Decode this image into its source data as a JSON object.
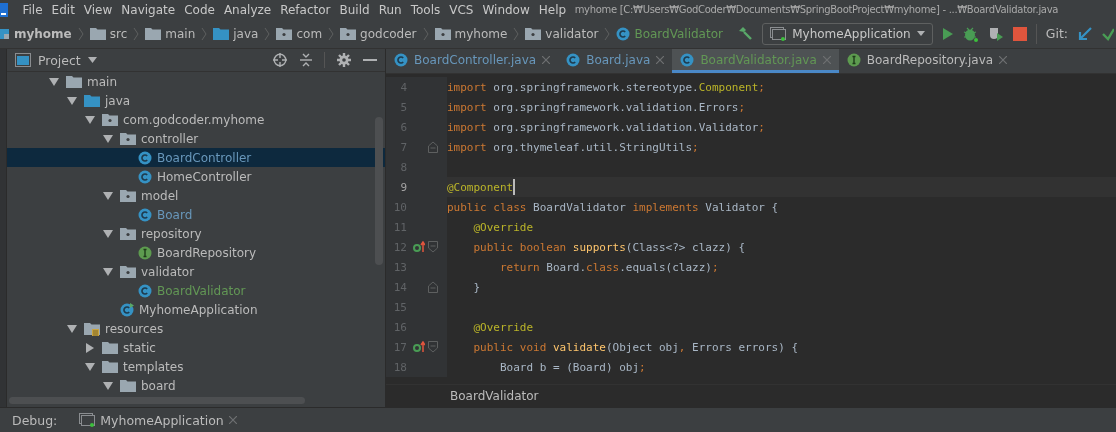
{
  "menu_bar": {
    "items": [
      "File",
      "Edit",
      "View",
      "Navigate",
      "Code",
      "Analyze",
      "Refactor",
      "Build",
      "Run",
      "Tools",
      "VCS",
      "Window",
      "Help"
    ],
    "title": "myhome [C:₩Users₩GodCoder₩Documents₩SpringBootProject₩myhome] - ...₩BoardValidator.java"
  },
  "navigation_bar": {
    "breadcrumbs": [
      {
        "label": "myhome",
        "kind": "module",
        "color": "#bbbbbb"
      },
      {
        "label": "src",
        "kind": "folder",
        "color": "#bbbbbb"
      },
      {
        "label": "main",
        "kind": "folder",
        "color": "#bbbbbb"
      },
      {
        "label": "java",
        "kind": "source-folder",
        "color": "#bbbbbb"
      },
      {
        "label": "com",
        "kind": "package",
        "color": "#bbbbbb"
      },
      {
        "label": "godcoder",
        "kind": "package",
        "color": "#bbbbbb"
      },
      {
        "label": "myhome",
        "kind": "package",
        "color": "#bbbbbb"
      },
      {
        "label": "validator",
        "kind": "package",
        "color": "#bbbbbb"
      },
      {
        "label": "BoardValidator",
        "kind": "class",
        "color": "#629755"
      }
    ],
    "run_configuration": "MyhomeApplication",
    "vcs_label": "Git:"
  },
  "project_panel": {
    "title": "Project",
    "tree": [
      {
        "label": "main",
        "kind": "folder",
        "expanded": true,
        "selected": false,
        "color": "#bbbbbb",
        "children": [
          {
            "label": "java",
            "kind": "source-folder",
            "expanded": true,
            "selected": false,
            "color": "#bbbbbb",
            "children": [
              {
                "label": "com.godcoder.myhome",
                "kind": "package",
                "expanded": true,
                "selected": false,
                "color": "#bbbbbb",
                "children": [
                  {
                    "label": "controller",
                    "kind": "package",
                    "expanded": true,
                    "selected": false,
                    "color": "#bbbbbb",
                    "children": [
                      {
                        "label": "BoardController",
                        "kind": "class",
                        "selected": true,
                        "color": "#6897bb"
                      },
                      {
                        "label": "HomeController",
                        "kind": "class",
                        "selected": false,
                        "color": "#bbbbbb"
                      }
                    ]
                  },
                  {
                    "label": "model",
                    "kind": "package",
                    "expanded": true,
                    "selected": false,
                    "color": "#bbbbbb",
                    "children": [
                      {
                        "label": "Board",
                        "kind": "class",
                        "selected": false,
                        "color": "#6897bb"
                      }
                    ]
                  },
                  {
                    "label": "repository",
                    "kind": "package",
                    "expanded": true,
                    "selected": false,
                    "color": "#bbbbbb",
                    "children": [
                      {
                        "label": "BoardRepository",
                        "kind": "interface",
                        "selected": false,
                        "color": "#bbbbbb"
                      }
                    ]
                  },
                  {
                    "label": "validator",
                    "kind": "package",
                    "expanded": true,
                    "selected": false,
                    "color": "#bbbbbb",
                    "children": [
                      {
                        "label": "BoardValidator",
                        "kind": "class",
                        "selected": false,
                        "color": "#629755"
                      }
                    ]
                  },
                  {
                    "label": "MyhomeApplication",
                    "kind": "main-class",
                    "selected": false,
                    "color": "#bbbbbb"
                  }
                ]
              }
            ]
          },
          {
            "label": "resources",
            "kind": "resources-folder",
            "expanded": true,
            "selected": false,
            "color": "#bbbbbb",
            "children": [
              {
                "label": "static",
                "kind": "folder",
                "expanded": false,
                "selected": false,
                "color": "#bbbbbb"
              },
              {
                "label": "templates",
                "kind": "folder",
                "expanded": true,
                "selected": false,
                "color": "#bbbbbb",
                "children": [
                  {
                    "label": "board",
                    "kind": "folder",
                    "expanded": true,
                    "selected": false,
                    "color": "#bbbbbb"
                  }
                ]
              }
            ]
          }
        ]
      }
    ]
  },
  "editor": {
    "tabs": [
      {
        "label": "BoardController.java",
        "kind": "class",
        "color": "#6897bb",
        "selected": false
      },
      {
        "label": "Board.java",
        "kind": "class",
        "color": "#6897bb",
        "selected": false
      },
      {
        "label": "BoardValidator.java",
        "kind": "class",
        "color": "#629755",
        "selected": true
      },
      {
        "label": "BoardRepository.java",
        "kind": "interface",
        "color": "#bbbbbb",
        "selected": false
      }
    ],
    "lines": [
      {
        "number": "4",
        "current": false,
        "override": false,
        "fold_start": false,
        "fold_end": false,
        "tokens": [
          {
            "kind": "keyword",
            "text": "import "
          },
          {
            "kind": "plain",
            "text": "org.springframework.stereotype."
          },
          {
            "kind": "annotation",
            "text": "Component"
          },
          {
            "kind": "keyword",
            "text": ";"
          }
        ]
      },
      {
        "number": "5",
        "current": false,
        "override": false,
        "fold_start": false,
        "fold_end": false,
        "tokens": [
          {
            "kind": "keyword",
            "text": "import "
          },
          {
            "kind": "plain",
            "text": "org.springframework.validation.Errors"
          },
          {
            "kind": "keyword",
            "text": ";"
          }
        ]
      },
      {
        "number": "6",
        "current": false,
        "override": false,
        "fold_start": false,
        "fold_end": false,
        "tokens": [
          {
            "kind": "keyword",
            "text": "import "
          },
          {
            "kind": "plain",
            "text": "org.springframework.validation.Validator"
          },
          {
            "kind": "keyword",
            "text": ";"
          }
        ]
      },
      {
        "number": "7",
        "current": false,
        "override": false,
        "fold_start": false,
        "fold_end": true,
        "tokens": [
          {
            "kind": "keyword",
            "text": "import "
          },
          {
            "kind": "plain",
            "text": "org.thymeleaf.util.StringUtils"
          },
          {
            "kind": "keyword",
            "text": ";"
          }
        ]
      },
      {
        "number": "8",
        "current": false,
        "override": false,
        "fold_start": false,
        "fold_end": false
      },
      {
        "number": "9",
        "current": true,
        "override": false,
        "fold_start": false,
        "fold_end": false,
        "tokens": [
          {
            "kind": "annotation",
            "text": "@Component"
          }
        ]
      },
      {
        "number": "10",
        "current": false,
        "override": false,
        "fold_start": false,
        "fold_end": false,
        "tokens": [
          {
            "kind": "keyword",
            "text": "public class "
          },
          {
            "kind": "plain",
            "text": "BoardValidator "
          },
          {
            "kind": "keyword",
            "text": "implements "
          },
          {
            "kind": "plain",
            "text": "Validator {"
          }
        ]
      },
      {
        "number": "11",
        "current": false,
        "override": false,
        "fold_start": false,
        "fold_end": false,
        "tokens": [
          {
            "kind": "annotation",
            "text": "    @Override"
          }
        ]
      },
      {
        "number": "12",
        "current": false,
        "override": true,
        "fold_start": true,
        "fold_end": false,
        "tokens": [
          {
            "kind": "keyword",
            "text": "    public boolean "
          },
          {
            "kind": "method",
            "text": "supports"
          },
          {
            "kind": "plain",
            "text": "(Class<?> clazz) {"
          }
        ]
      },
      {
        "number": "13",
        "current": false,
        "override": false,
        "fold_start": false,
        "fold_end": false,
        "tokens": [
          {
            "kind": "keyword",
            "text": "        return "
          },
          {
            "kind": "plain",
            "text": "Board."
          },
          {
            "kind": "keyword",
            "text": "class"
          },
          {
            "kind": "plain",
            "text": ".equals(clazz)"
          },
          {
            "kind": "keyword",
            "text": ";"
          }
        ]
      },
      {
        "number": "14",
        "current": false,
        "override": false,
        "fold_start": false,
        "fold_end": true,
        "tokens": [
          {
            "kind": "plain",
            "text": "    }"
          }
        ]
      },
      {
        "number": "15",
        "current": false,
        "override": false,
        "fold_start": false,
        "fold_end": false
      },
      {
        "number": "16",
        "current": false,
        "override": false,
        "fold_start": false,
        "fold_end": false,
        "tokens": [
          {
            "kind": "annotation",
            "text": "    @Override"
          }
        ]
      },
      {
        "number": "17",
        "current": false,
        "override": true,
        "fold_start": true,
        "fold_end": false,
        "tokens": [
          {
            "kind": "keyword",
            "text": "    public void "
          },
          {
            "kind": "method",
            "text": "validate"
          },
          {
            "kind": "plain",
            "text": "(Object obj"
          },
          {
            "kind": "keyword",
            "text": ","
          },
          {
            "kind": "plain",
            "text": " Errors errors) {"
          }
        ]
      },
      {
        "number": "18",
        "current": false,
        "override": false,
        "fold_start": false,
        "fold_end": false,
        "tokens": [
          {
            "kind": "plain",
            "text": "        Board b = (Board) obj"
          },
          {
            "kind": "keyword",
            "text": ";"
          }
        ]
      }
    ],
    "breadcrumb": "BoardValidator"
  },
  "debug_bar": {
    "label": "Debug:",
    "tabs": [
      {
        "label": "MyhomeApplication"
      }
    ]
  }
}
